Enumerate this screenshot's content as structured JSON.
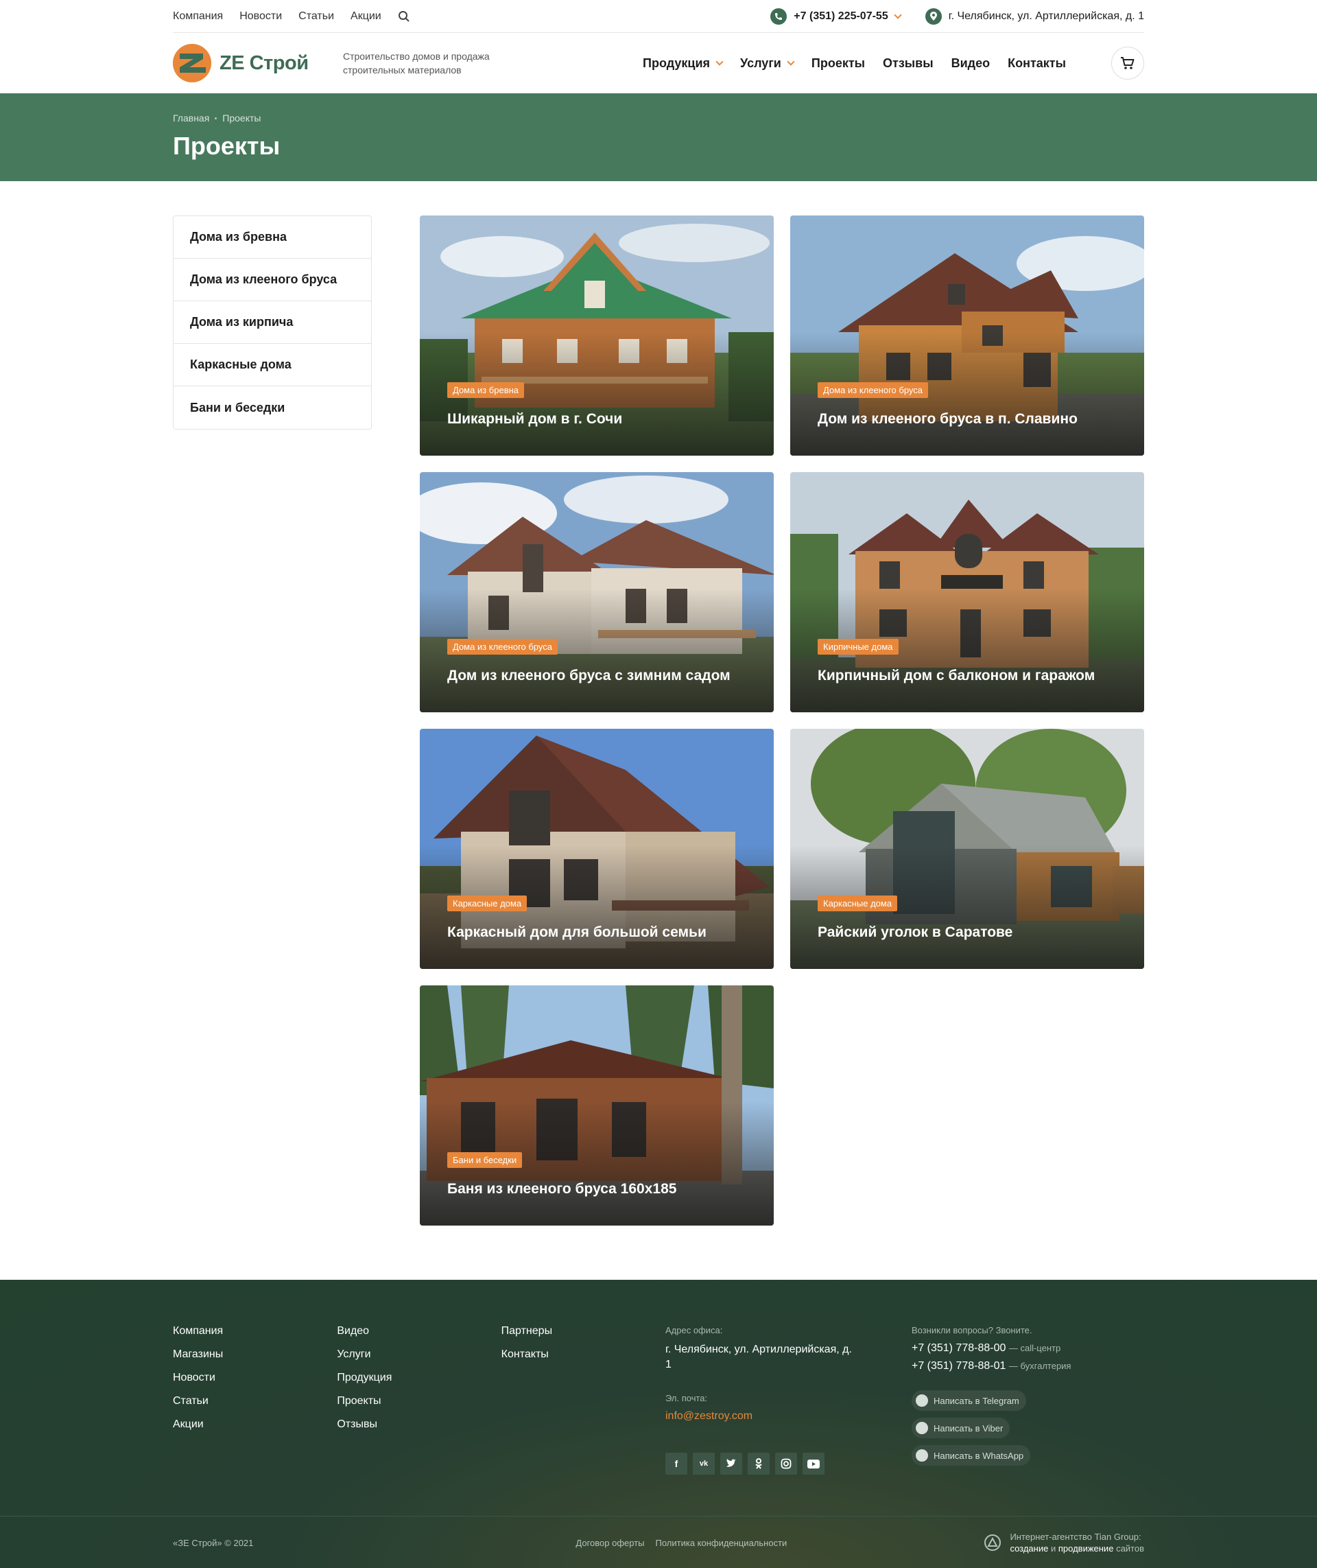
{
  "topbar": {
    "links": [
      "Компания",
      "Новости",
      "Статьи",
      "Акции"
    ],
    "phone": "+7 (351) 225-07-55",
    "address": "г. Челябинск, ул. Артиллерийская, д. 1"
  },
  "header": {
    "logo_text": "ZE Строй",
    "tagline": "Строительство домов и продажа строительных материалов",
    "nav": [
      {
        "label": "Продукция",
        "dropdown": true
      },
      {
        "label": "Услуги",
        "dropdown": true
      },
      {
        "label": "Проекты",
        "dropdown": false
      },
      {
        "label": "Отзывы",
        "dropdown": false
      },
      {
        "label": "Видео",
        "dropdown": false
      },
      {
        "label": "Контакты",
        "dropdown": false
      }
    ]
  },
  "banner": {
    "breadcrumbs": [
      "Главная",
      "Проекты"
    ],
    "title": "Проекты"
  },
  "sidebar": {
    "items": [
      "Дома из бревна",
      "Дома из клееного бруса",
      "Дома из кирпича",
      "Каркасные дома",
      "Бани и беседки"
    ]
  },
  "projects": [
    {
      "tag": "Дома из бревна",
      "title": "Шикарный дом в г. Сочи"
    },
    {
      "tag": "Дома из клееного бруса",
      "title": "Дом из клееного бруса в п. Славино"
    },
    {
      "tag": "Дома из клееного бруса",
      "title": "Дом из клееного бруса с зимним садом"
    },
    {
      "tag": "Кирпичные дома",
      "title": "Кирпичный дом с балконом и гаражом"
    },
    {
      "tag": "Каркасные дома",
      "title": "Каркасный дом для большой семьи"
    },
    {
      "tag": "Каркасные дома",
      "title": "Райский уголок в Саратове"
    },
    {
      "tag": "Бани и беседки",
      "title": "Баня из клееного бруса 160х185"
    }
  ],
  "footer": {
    "col1": [
      "Компания",
      "Магазины",
      "Новости",
      "Статьи",
      "Акции"
    ],
    "col2": [
      "Видео",
      "Услуги",
      "Продукция",
      "Проекты",
      "Отзывы"
    ],
    "col3": [
      "Партнеры",
      "Контакты"
    ],
    "address_label": "Адрес офиса:",
    "address": "г. Челябинск, ул. Артиллерийская, д. 1",
    "email_label": "Эл. почта:",
    "email": "info@zestroy.com",
    "socials": [
      "f",
      "vk",
      "tw",
      "ok",
      "ig",
      "yt"
    ],
    "contact_label": "Возникли вопросы? Звоните.",
    "phones": [
      {
        "number": "+7 (351) 778-88-00",
        "note": "— call-центр"
      },
      {
        "number": "+7 (351) 778-88-01",
        "note": "— бухгалтерия"
      }
    ],
    "messengers": [
      "Написать в Telegram",
      "Написать в Viber",
      "Написать в WhatsApp"
    ],
    "copyright": "«ЗЕ Строй» © 2021",
    "legal": [
      "Договор оферты",
      "Политика конфиденциальности"
    ],
    "agency_line1": "Интернет-агентство Tian Group:",
    "agency_w1": "создание",
    "agency_w2": "и",
    "agency_w3": "продвижение",
    "agency_w4": "сайтов"
  },
  "colors": {
    "accent": "#e8873a",
    "brand": "#47795d",
    "footer": "#24402f"
  },
  "icons": {
    "phone": "phone-icon",
    "location": "location-pin-icon",
    "search": "search-icon",
    "cart": "cart-icon"
  }
}
